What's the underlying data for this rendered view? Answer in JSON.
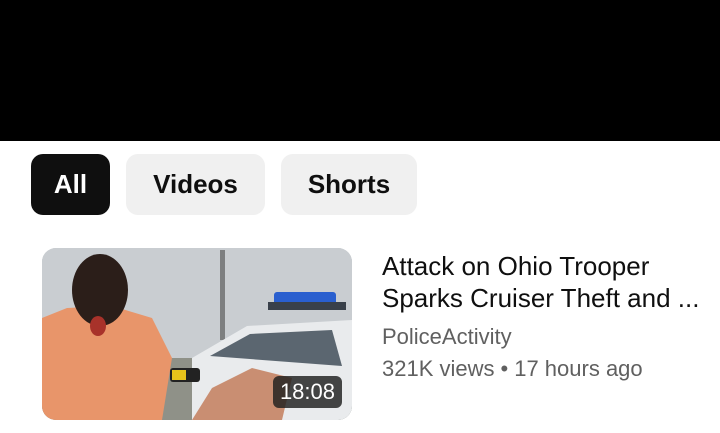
{
  "filters": {
    "all": "All",
    "videos": "Videos",
    "shorts": "Shorts"
  },
  "result": {
    "title_line1": "Attack on Ohio Trooper",
    "title_line2": "Sparks Cruiser Theft and ...",
    "channel": "PoliceActivity",
    "views": "321K views",
    "separator": "•",
    "age": "17 hours ago",
    "duration": "18:08"
  },
  "colors": {
    "active_chip_bg": "#0f0f0f",
    "chip_bg": "#f0f0f0",
    "secondary_text": "#606060"
  }
}
